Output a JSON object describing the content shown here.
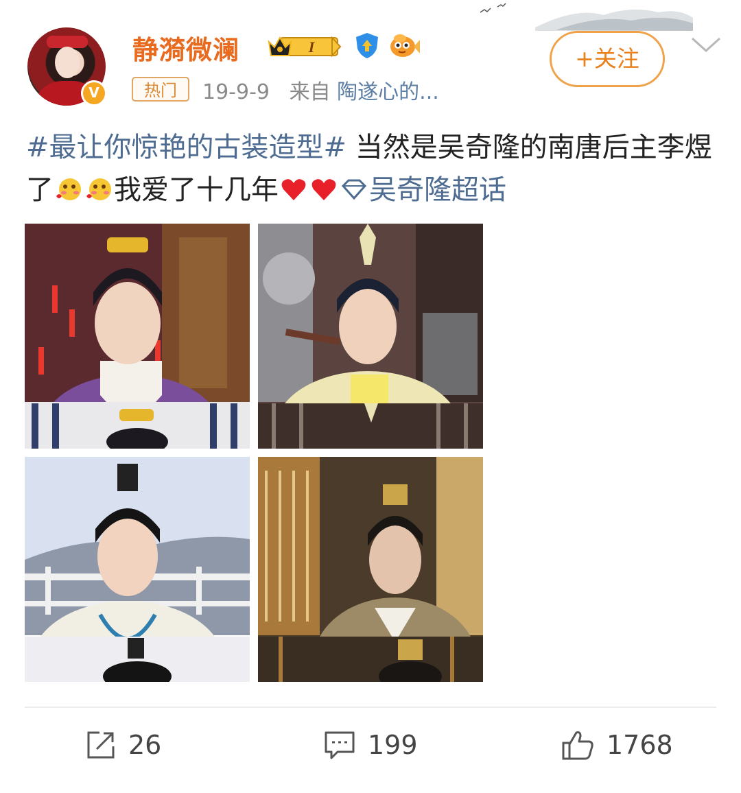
{
  "post": {
    "user": {
      "name": "静漪微澜",
      "level_badge": "I",
      "verified": "V"
    },
    "hot_tag": "热门",
    "date": "19-9-9",
    "source_prefix": "来自",
    "source_name": "陶遂心的...",
    "follow_label": "+关注",
    "text": {
      "topic": "#最让你惊艳的古装造型#",
      "part1": " 当然是吴奇隆的南唐后主李煜了",
      "part2": "我爱了十几年",
      "supertopic": "吴奇隆超话"
    },
    "images": [
      {
        "id": "photo-1",
        "tone": "purple"
      },
      {
        "id": "photo-2",
        "tone": "gold"
      },
      {
        "id": "photo-3",
        "tone": "white"
      },
      {
        "id": "photo-4",
        "tone": "brocade"
      }
    ],
    "actions": {
      "repost_count": "26",
      "comment_count": "199",
      "like_count": "1768"
    }
  },
  "icons": [
    "repost-icon",
    "comment-icon",
    "like-icon",
    "chevron-down-icon",
    "diamond-icon",
    "heart-icon",
    "blush-emoji-icon"
  ],
  "colors": {
    "username": "#e86b1f",
    "topic": "#4e6b91",
    "follow": "#e8801c",
    "hot_tag": "#d98a36",
    "heart": "#e8202a"
  }
}
